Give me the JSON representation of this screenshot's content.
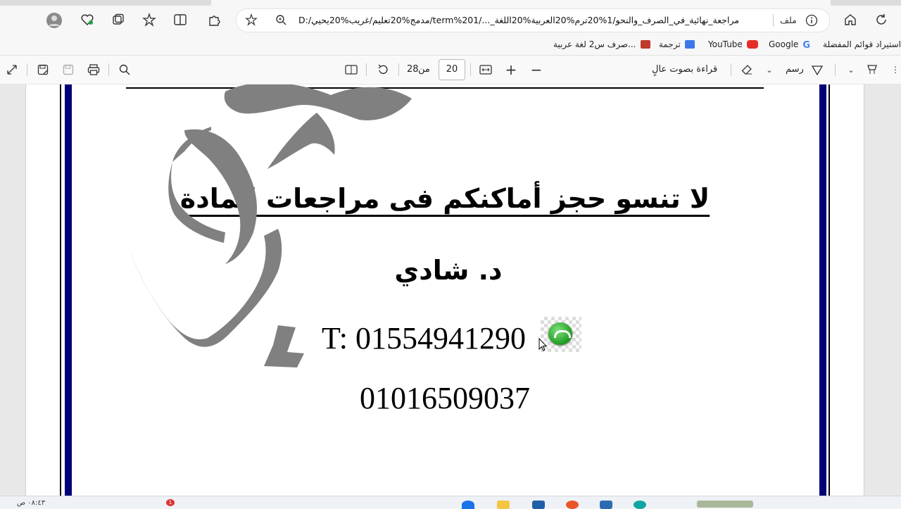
{
  "browser": {
    "address": {
      "file_label": "ملف",
      "url": "D:/مدمج%20تعليم/غريب%20يحيي/term%201/..._مراجعة_نهائية_في_الصرف_والنحو/1%20ترم%20العربية%20اللغة"
    },
    "favorites": [
      {
        "label": "استيراد قوائم المفضلة",
        "icon": "import-icon",
        "color": "#999999"
      },
      {
        "label": "Google",
        "icon": "google-icon",
        "color": "#4285f4"
      },
      {
        "label": "YouTube",
        "icon": "youtube-icon",
        "color": "#e52d27"
      },
      {
        "label": "ترجمة",
        "icon": "translate-icon",
        "color": "#3b78e7"
      },
      {
        "label": "صرف س2 لغة عربية...",
        "icon": "pdf-icon",
        "color": "#c0392b"
      }
    ]
  },
  "pdf_toolbar": {
    "current_page": "20",
    "of_label": "من",
    "total_pages": "28",
    "read_aloud": "قراءة بصوت عالٍ",
    "draw": "رسم"
  },
  "document": {
    "heading": "لا تنسو حجز أماكنكم فى مراجعات المادة",
    "doctor": "د. شادي",
    "phone_1": "T: 01554941290",
    "phone_2": "01016509037"
  },
  "taskbar": {
    "time": "٠٨:٤٣ ص",
    "badge": "1"
  }
}
